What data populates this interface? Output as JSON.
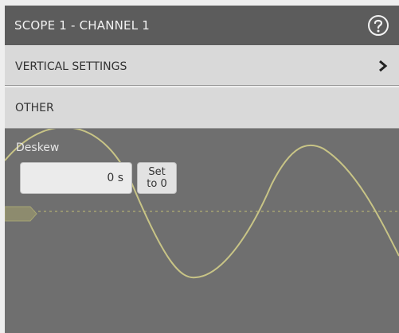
{
  "header": {
    "title": "SCOPE 1 - CHANNEL 1",
    "help_icon": "help-circle-icon"
  },
  "sections": {
    "vertical_settings": {
      "label": "VERTICAL SETTINGS",
      "icon": "chevron-right-icon"
    },
    "other": {
      "label": "OTHER"
    }
  },
  "deskew": {
    "label": "Deskew",
    "value": "0 s",
    "set_button_line1": "Set",
    "set_button_line2": "to 0"
  },
  "colors": {
    "header_bg": "#5c5c5c",
    "row_bg": "#d9d9d9",
    "content_bg": "#6f6f6f",
    "waveform": "#c8c486"
  }
}
